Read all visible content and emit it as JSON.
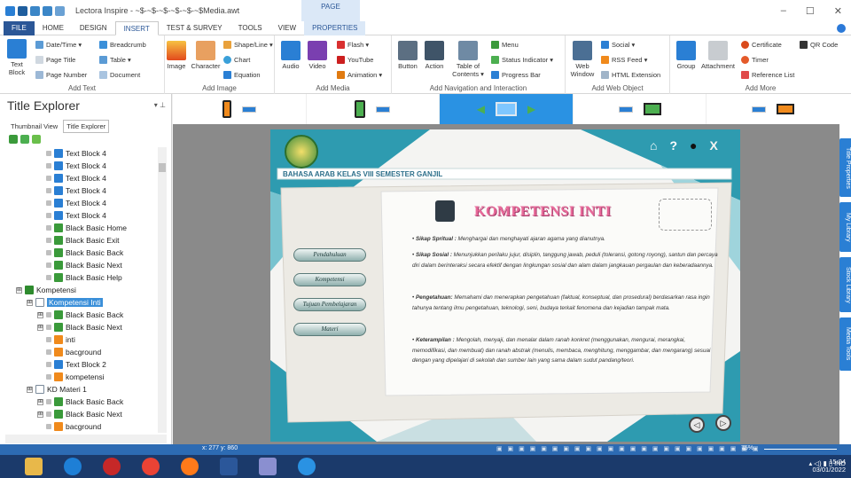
{
  "window": {
    "title": "Lectora Inspire - ~$-~$-~$-~$-~$-~$Media.awt",
    "context_tab": "PAGE",
    "controls": [
      "–",
      "☐",
      "✕"
    ]
  },
  "tabs": [
    "FILE",
    "HOME",
    "DESIGN",
    "INSERT",
    "TEST & SURVEY",
    "TOOLS",
    "VIEW",
    "PROPERTIES"
  ],
  "ribbon": {
    "groups": [
      "Add Text",
      "Add Image",
      "Add Media",
      "Add Navigation and Interaction",
      "Add Web Object",
      "Add More"
    ],
    "text_block": "Text\nBlock",
    "date_time": "Date/Time ▾",
    "page_title": "Page Title",
    "page_number": "Page Number",
    "breadcrumb": "Breadcrumb",
    "table": "Table ▾",
    "document": "Document",
    "image": "Image",
    "character": "Character",
    "shape_line": "Shape/Line ▾",
    "chart": "Chart",
    "equation": "Equation",
    "audio": "Audio",
    "video": "Video",
    "flash": "Flash ▾",
    "youtube": "YouTube",
    "animation": "Animation ▾",
    "button": "Button",
    "action": "Action",
    "toc": "Table of\nContents ▾",
    "menu": "Menu",
    "status_indicator": "Status Indicator ▾",
    "progress_bar": "Progress Bar",
    "web_window": "Web\nWindow",
    "social": "Social ▾",
    "rss_feed": "RSS Feed ▾",
    "html_extension": "HTML Extension",
    "group": "Group",
    "attachment": "Attachment",
    "certificate": "Certificate",
    "timer": "Timer",
    "reference_list": "Reference List",
    "qr_code": "QR Code"
  },
  "panel": {
    "title": "Title Explorer",
    "tabs": [
      "Thumbnail View",
      "Title Explorer"
    ],
    "tree": [
      {
        "label": "Text Block 4",
        "indent": 3,
        "icon": "text",
        "exp": false
      },
      {
        "label": "Text Block 4",
        "indent": 3,
        "icon": "text",
        "exp": false
      },
      {
        "label": "Text Block 4",
        "indent": 3,
        "icon": "text",
        "exp": false
      },
      {
        "label": "Text Block 4",
        "indent": 3,
        "icon": "text",
        "exp": false
      },
      {
        "label": "Text Block 4",
        "indent": 3,
        "icon": "text",
        "exp": false
      },
      {
        "label": "Text Block 4",
        "indent": 3,
        "icon": "text",
        "exp": false
      },
      {
        "label": "Black Basic Home",
        "indent": 3,
        "icon": "btn",
        "exp": false
      },
      {
        "label": "Black Basic Exit",
        "indent": 3,
        "icon": "btn",
        "exp": false
      },
      {
        "label": "Black Basic Back",
        "indent": 3,
        "icon": "btn",
        "exp": false
      },
      {
        "label": "Black Basic Next",
        "indent": 3,
        "icon": "btn",
        "exp": false
      },
      {
        "label": "Black Basic Help",
        "indent": 3,
        "icon": "btn",
        "exp": false
      },
      {
        "label": "Kompetensi",
        "indent": 1,
        "icon": "chapter",
        "exp": true
      },
      {
        "label": "Kompetensi Inti",
        "indent": 2,
        "icon": "page",
        "exp": true,
        "selected": true
      },
      {
        "label": "Black Basic Back",
        "indent": 3,
        "icon": "btn",
        "exp": true
      },
      {
        "label": "Black Basic Next",
        "indent": 3,
        "icon": "btn",
        "exp": true
      },
      {
        "label": "inti",
        "indent": 3,
        "icon": "img",
        "exp": false
      },
      {
        "label": "bacground",
        "indent": 3,
        "icon": "img",
        "exp": false
      },
      {
        "label": "Text Block 2",
        "indent": 3,
        "icon": "text",
        "exp": false
      },
      {
        "label": "kompetensi",
        "indent": 3,
        "icon": "img",
        "exp": false
      },
      {
        "label": "KD Materi 1",
        "indent": 2,
        "icon": "page",
        "exp": true
      },
      {
        "label": "Black Basic Back",
        "indent": 3,
        "icon": "btn",
        "exp": true
      },
      {
        "label": "Black Basic Next",
        "indent": 3,
        "icon": "btn",
        "exp": true
      },
      {
        "label": "bacground",
        "indent": 3,
        "icon": "img",
        "exp": false
      }
    ]
  },
  "slide": {
    "header": "BAHASA ARAB KELAS VIII SEMESTER GANJIL",
    "heading": "KOMPETENSI INTI",
    "nav": [
      "Pendahuluan",
      "Kompetensi",
      "Tujuan Pembelajaran",
      "Materi"
    ],
    "items": [
      {
        "label": "Sikap Spritual :",
        "text": " Menghargai dan menghayati ajaran agama yang dianutnya."
      },
      {
        "label": "Sikap Sosial :",
        "text": " Menunjukkan perilaku jujur, disiplin, tanggung jawab, peduli (toleransi, gotong royong), santun dan percaya diri dalam berinteraksi secara efektif dengan lingkungan sosial dan alam dalam jangkauan pergaulan dan keberadaannya."
      },
      {
        "label": "Pengetahuan:",
        "text": " Memahami dan menerapkan pengetahuan (faktual, konseptual, dan prosedural) berdasarkan rasa ingin tahunya tentang ilmu pengetahuan, teknologi, seni, budaya terkait fenomena dan kejadian tampak mata."
      },
      {
        "label": "Keterampilan :",
        "text": " Mengolah, menyaji, dan menalar dalam ranah konkret (menggunakan, mengurai, merangkai, memodifikasi, dan membuat) dan ranah abstrak (menulis, membaca, menghitung, menggambar, dan mengarang) sesuai dengan yang dipelajari di sekolah dan sumber lain yang sama dalam sudut pandang/teori."
      }
    ]
  },
  "right_tabs": [
    "Title Properties",
    "My Library",
    "Stock Library",
    "Media Tools"
  ],
  "status": {
    "coords": "x: 277 y: 860",
    "zoom": "75%"
  },
  "tray": {
    "lang": "IND",
    "time": "15:04",
    "date": "03/01/2022"
  }
}
